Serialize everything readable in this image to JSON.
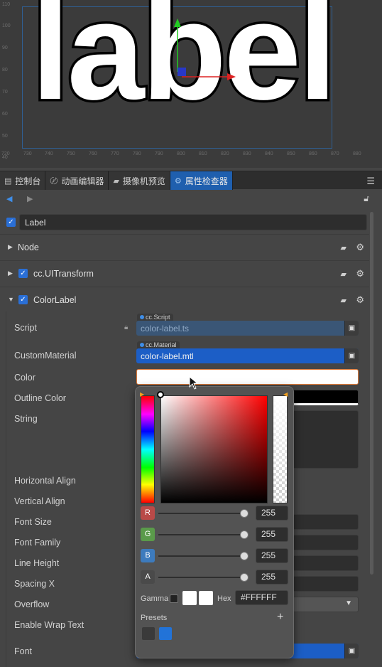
{
  "scene": {
    "ruler_y": [
      "110",
      "100",
      "90",
      "80",
      "70",
      "60",
      "50",
      "40"
    ],
    "ruler_x": [
      "720",
      "730",
      "740",
      "750",
      "760",
      "770",
      "780",
      "790",
      "800",
      "810",
      "820",
      "830",
      "840",
      "850",
      "860",
      "870",
      "880"
    ],
    "label_text": "label"
  },
  "tabs": [
    {
      "label": "控制台"
    },
    {
      "label": "动画编辑器"
    },
    {
      "label": "摄像机预览"
    },
    {
      "label": "属性检查器"
    }
  ],
  "node_name": "Label",
  "components": [
    {
      "title": "Node"
    },
    {
      "title": "cc.UITransform"
    },
    {
      "title": "ColorLabel"
    }
  ],
  "props": {
    "script": {
      "label": "Script",
      "tag": "cc.Script",
      "value": "color-label.ts"
    },
    "material": {
      "label": "CustomMaterial",
      "tag": "cc.Material",
      "value": "color-label.mtl"
    },
    "color": "Color",
    "outline_color": "Outline Color",
    "string": "String",
    "h_align": "Horizontal Align",
    "v_align": "Vertical Align",
    "font_size": "Font Size",
    "font_family": "Font Family",
    "line_height": "Line Height",
    "spacing_x": "Spacing X",
    "overflow": "Overflow",
    "wrap": "Enable Wrap Text",
    "font": "Font"
  },
  "picker": {
    "channels": [
      {
        "name": "R",
        "value": "255",
        "color": "#b94a48"
      },
      {
        "name": "G",
        "value": "255",
        "color": "#5a9a4a"
      },
      {
        "name": "B",
        "value": "255",
        "color": "#3d7bbd"
      },
      {
        "name": "A",
        "value": "255",
        "color": "#4a4a4a"
      }
    ],
    "gamma_label": "Gamma",
    "hex_label": "Hex",
    "hex_value": "#FFFFFF",
    "presets_label": "Presets",
    "add": "+"
  },
  "colors": {
    "accent": "#1f5fae",
    "selected": "#1c5ec6",
    "highlight": "#e07b39"
  }
}
